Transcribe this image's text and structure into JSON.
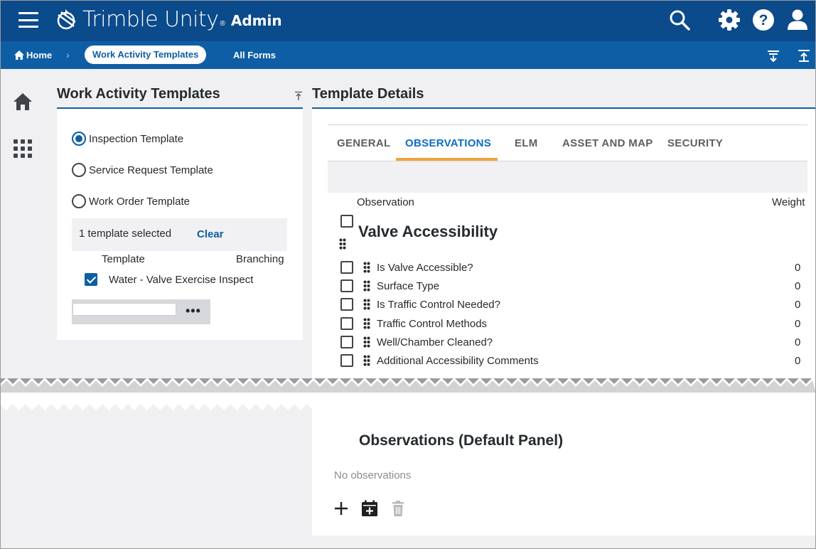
{
  "app": {
    "brand": "Trimble Unity",
    "brand_mark": "®",
    "section": "Admin"
  },
  "breadcrumb": {
    "home": "Home",
    "separator": "›",
    "current": "Work Activity Templates",
    "link": "All Forms"
  },
  "left_panel": {
    "title": "Work Activity Templates",
    "radios": [
      {
        "label": "Inspection Template",
        "selected": true
      },
      {
        "label": "Service Request Template",
        "selected": false
      },
      {
        "label": "Work Order Template",
        "selected": false
      }
    ],
    "selection_count": "1 template selected",
    "clear_label": "Clear",
    "columns": {
      "template": "Template",
      "branching": "Branching"
    },
    "templates": [
      {
        "name": "Water - Valve Exercise Inspect",
        "checked": true
      }
    ],
    "more_label": "•••"
  },
  "right_panel": {
    "title": "Template Details",
    "tabs": [
      {
        "label": "GENERAL",
        "active": false
      },
      {
        "label": "OBSERVATIONS",
        "active": true
      },
      {
        "label": "ELM",
        "active": false
      },
      {
        "label": "ASSET AND MAP",
        "active": false
      },
      {
        "label": "SECURITY",
        "active": false
      }
    ],
    "columns": {
      "observation": "Observation",
      "weight": "Weight"
    },
    "group_title": "Valve Accessibility",
    "observations": [
      {
        "label": "Is Valve Accessible?",
        "weight": "0"
      },
      {
        "label": "Surface Type",
        "weight": "0"
      },
      {
        "label": "Is Traffic Control Needed?",
        "weight": "0"
      },
      {
        "label": "Traffic Control Methods",
        "weight": "0"
      },
      {
        "label": "Well/Chamber Cleaned?",
        "weight": "0"
      },
      {
        "label": "Additional Accessibility Comments",
        "weight": "0"
      }
    ],
    "default_panel_title": "Observations (Default Panel)",
    "empty_text": "No observations"
  },
  "icons": {
    "menu": "hamburger-icon",
    "search": "search-icon",
    "settings": "gear-icon",
    "help": "help-icon",
    "user": "user-icon",
    "home": "home-icon",
    "apps": "apps-grid-icon",
    "add": "plus-icon",
    "add_calendar": "calendar-add-icon",
    "delete": "trash-icon"
  },
  "colors": {
    "header": "#0b4a8b",
    "subheader": "#0e5ea6",
    "accent": "#f0a33c",
    "active_tab": "#0e6cc4"
  }
}
